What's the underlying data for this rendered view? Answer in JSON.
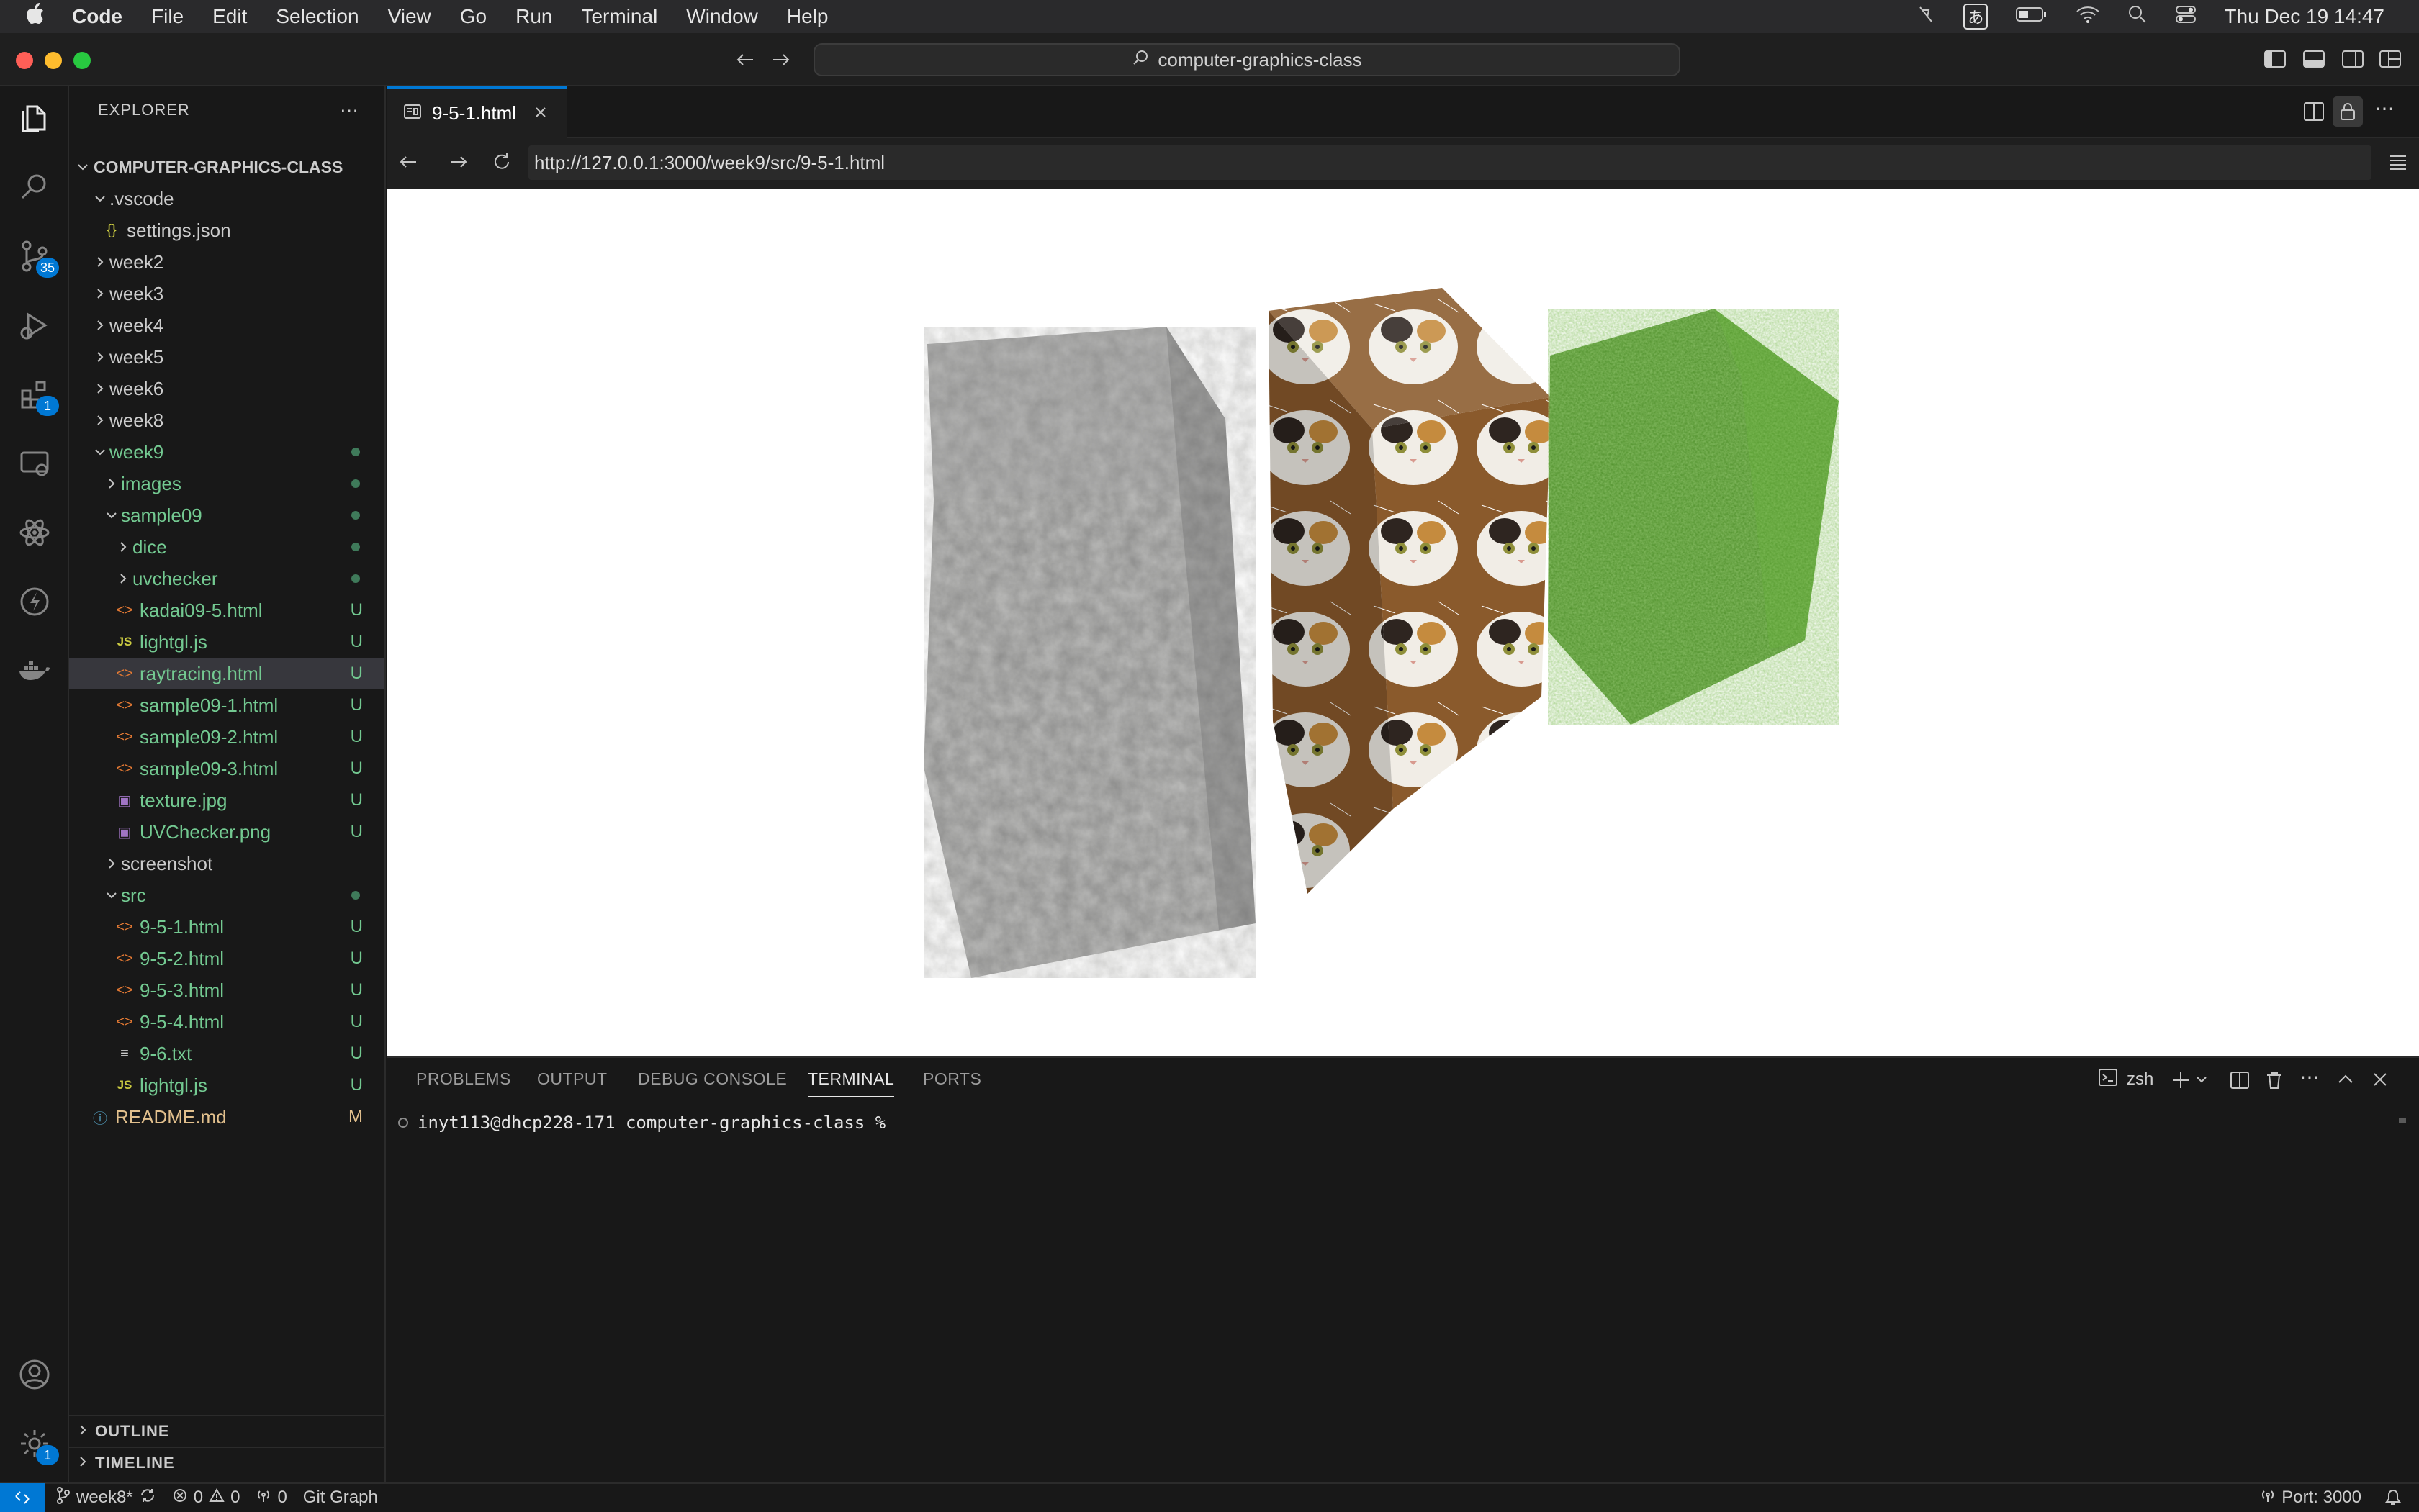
{
  "menubar": {
    "app": "Code",
    "items": [
      "File",
      "Edit",
      "Selection",
      "View",
      "Go",
      "Run",
      "Terminal",
      "Window",
      "Help"
    ],
    "ime": "あ",
    "clock": "Thu Dec 19  14:47"
  },
  "titlebar": {
    "command_center": "computer-graphics-class"
  },
  "activity": {
    "scm_badge": "35",
    "extensions_badge": "1",
    "settings_badge": "1"
  },
  "sidebar": {
    "title": "EXPLORER",
    "root": "COMPUTER-GRAPHICS-CLASS",
    "tree": [
      {
        "label": ".vscode",
        "status": ""
      },
      {
        "label": "settings.json",
        "status": ""
      },
      {
        "label": "week2",
        "status": ""
      },
      {
        "label": "week3",
        "status": ""
      },
      {
        "label": "week4",
        "status": ""
      },
      {
        "label": "week5",
        "status": ""
      },
      {
        "label": "week6",
        "status": ""
      },
      {
        "label": "week8",
        "status": ""
      },
      {
        "label": "week9",
        "status": ""
      },
      {
        "label": "images",
        "status": ""
      },
      {
        "label": "sample09",
        "status": ""
      },
      {
        "label": "dice",
        "status": ""
      },
      {
        "label": "uvchecker",
        "status": ""
      },
      {
        "label": "kadai09-5.html",
        "status": "U"
      },
      {
        "label": "lightgl.js",
        "status": "U"
      },
      {
        "label": "raytracing.html",
        "status": "U"
      },
      {
        "label": "sample09-1.html",
        "status": "U"
      },
      {
        "label": "sample09-2.html",
        "status": "U"
      },
      {
        "label": "sample09-3.html",
        "status": "U"
      },
      {
        "label": "texture.jpg",
        "status": "U"
      },
      {
        "label": "UVChecker.png",
        "status": "U"
      },
      {
        "label": "screenshot",
        "status": ""
      },
      {
        "label": "src",
        "status": ""
      },
      {
        "label": "9-5-1.html",
        "status": "U"
      },
      {
        "label": "9-5-2.html",
        "status": "U"
      },
      {
        "label": "9-5-3.html",
        "status": "U"
      },
      {
        "label": "9-5-4.html",
        "status": "U"
      },
      {
        "label": "9-6.txt",
        "status": "U"
      },
      {
        "label": "lightgl.js",
        "status": "U"
      },
      {
        "label": "README.md",
        "status": "M"
      }
    ],
    "outline": "OUTLINE",
    "timeline": "TIMELINE"
  },
  "editor": {
    "tab_label": "9-5-1.html",
    "url": "http://127.0.0.1:3000/week9/src/9-5-1.html"
  },
  "panel": {
    "tabs": [
      "PROBLEMS",
      "OUTPUT",
      "DEBUG CONSOLE",
      "TERMINAL",
      "PORTS"
    ],
    "shell": "zsh",
    "prompt": "inyt113@dhcp228-171 computer-graphics-class %"
  },
  "statusbar": {
    "branch": "week8*",
    "errors": "0",
    "warnings": "0",
    "ports": "0",
    "git_graph": "Git Graph",
    "port_info": "Port: 3000"
  },
  "colors": {
    "accent": "#0078d4",
    "untracked": "#73c991",
    "modified": "#e2c08d"
  }
}
